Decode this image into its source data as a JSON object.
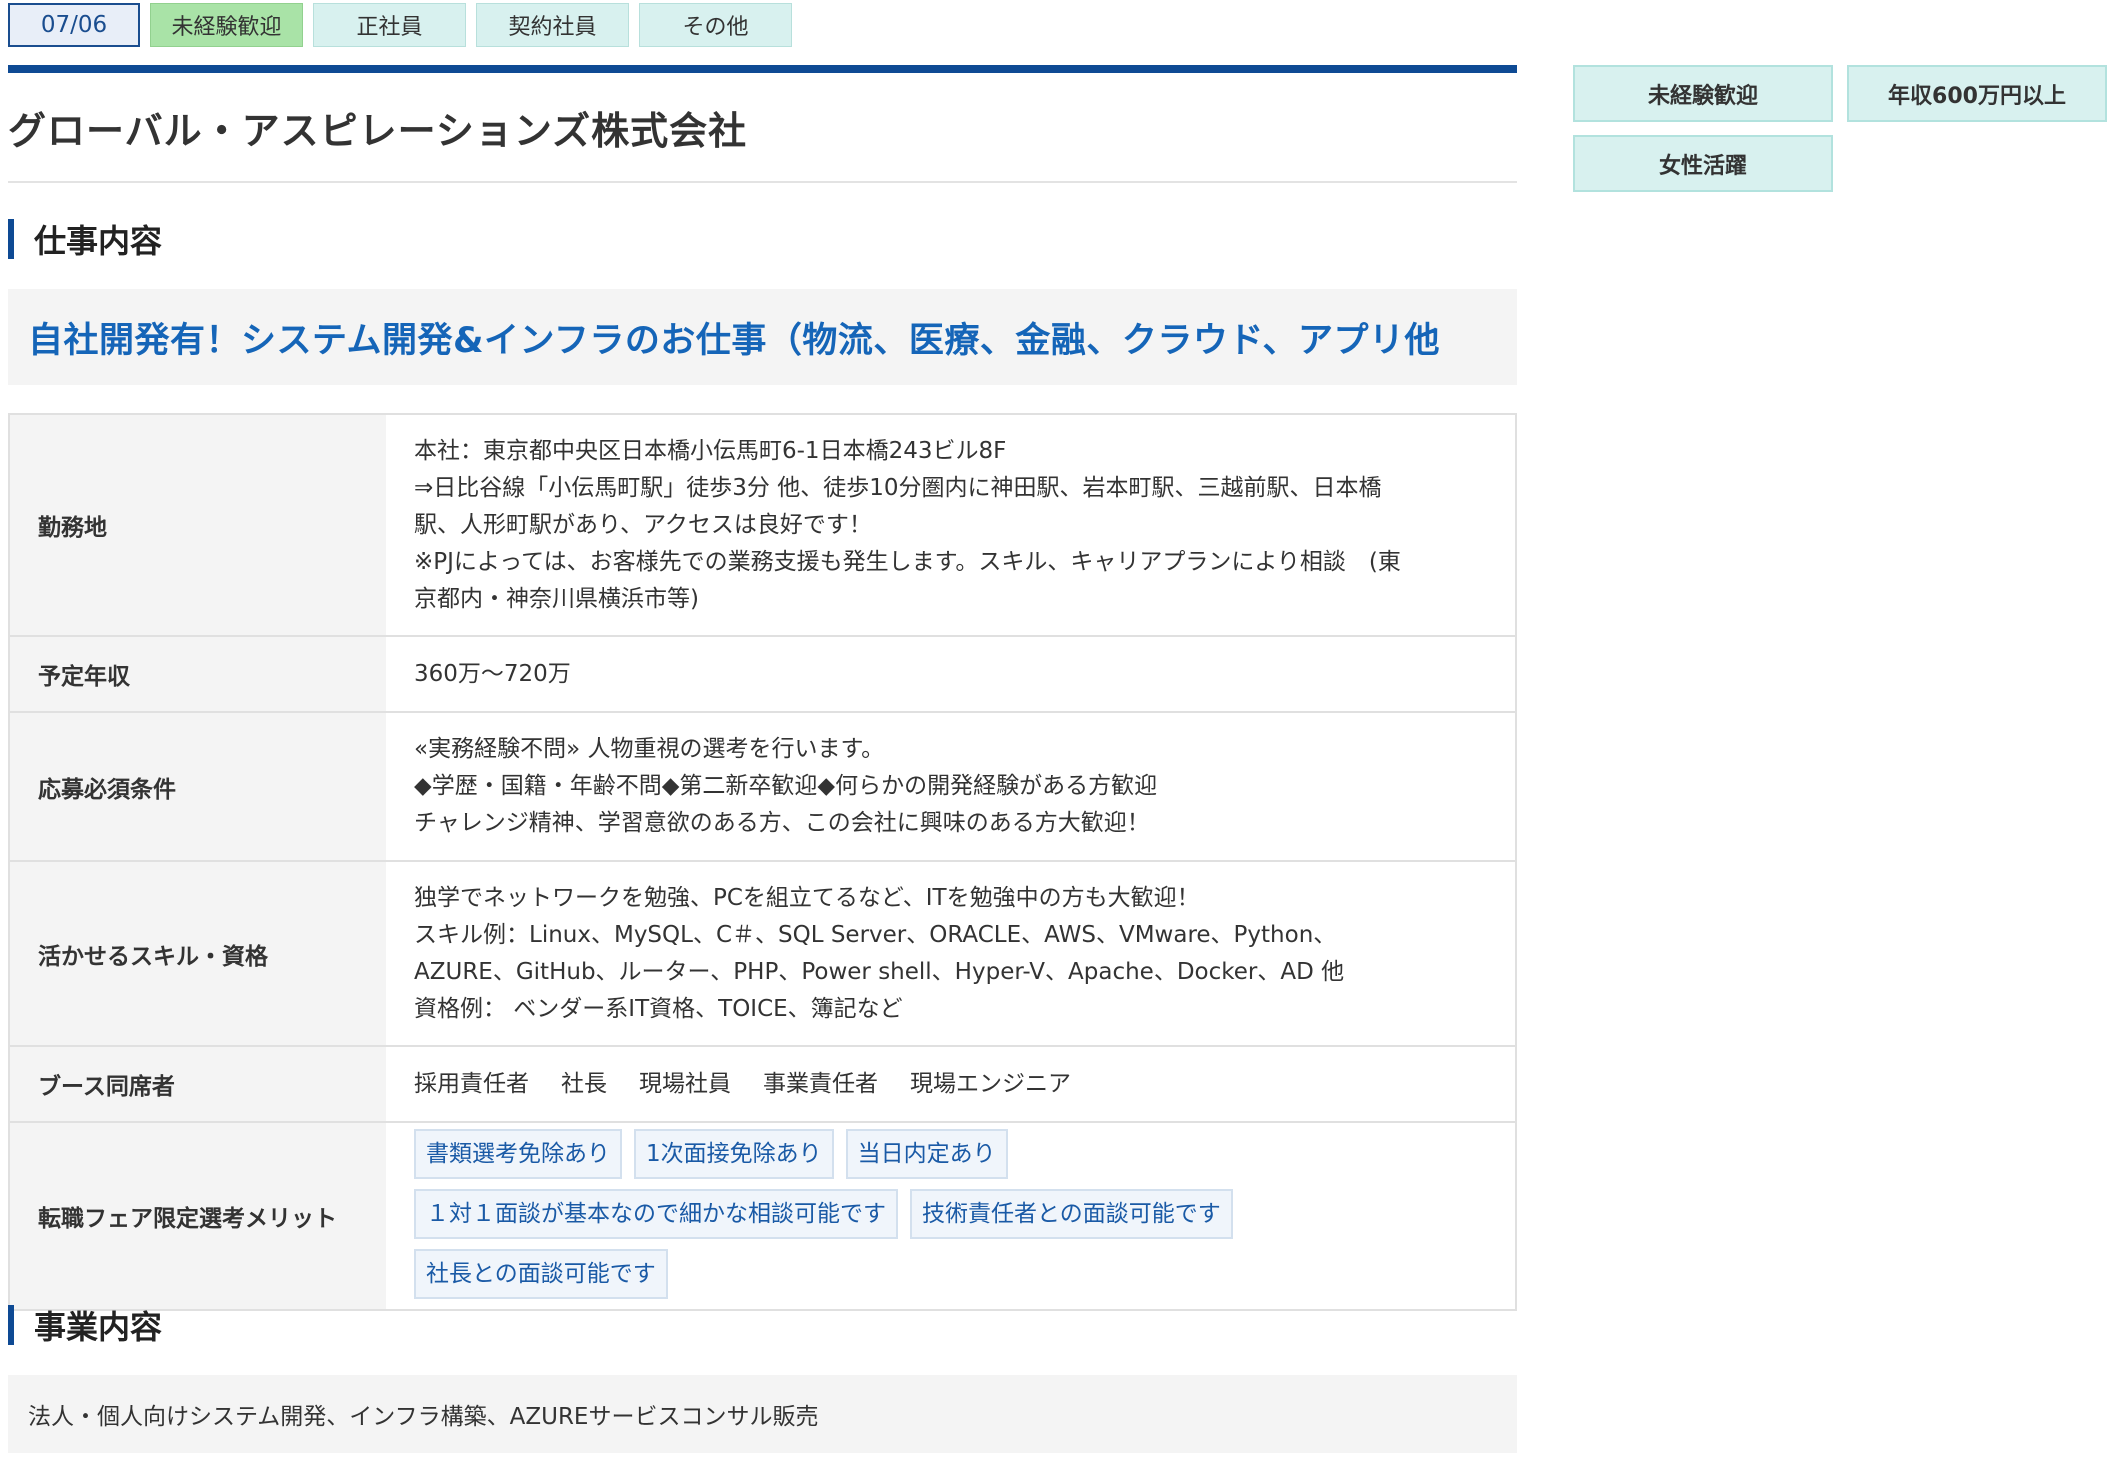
{
  "top": {
    "date": "07/06",
    "tags": [
      {
        "label": "未経験歓迎",
        "highlight": true
      },
      {
        "label": "正社員",
        "highlight": false
      },
      {
        "label": "契約社員",
        "highlight": false
      },
      {
        "label": "その他",
        "highlight": false
      }
    ]
  },
  "company": {
    "name": "グローバル・アスピレーションズ株式会社"
  },
  "job": {
    "heading": "仕事内容",
    "catch": "自社開発有！システム開発&インフラのお仕事（物流、医療、金融、クラウド、アプリ他"
  },
  "details": {
    "location": {
      "label": "勤務地",
      "lines": [
        "本社：東京都中央区日本橋小伝馬町6-1日本橋243ビル8F",
        "⇒日比谷線「小伝馬町駅」徒歩3分 他、徒歩10分圏内に神田駅、岩本町駅、三越前駅、日本橋",
        "駅、人形町駅があり、アクセスは良好です！",
        "※PJによっては、お客様先での業務支援も発生します。スキル、キャリアプランにより相談　(東",
        "京都内・神奈川県横浜市等)"
      ]
    },
    "salary": {
      "label": "予定年収",
      "value": "360万〜720万"
    },
    "requirements": {
      "label": "応募必須条件",
      "lines": [
        "«実務経験不問» 人物重視の選考を行います。",
        "◆学歴・国籍・年齢不問◆第二新卒歓迎◆何らかの開発経験がある方歓迎",
        "チャレンジ精神、学習意欲のある方、この会社に興味のある方大歓迎！"
      ]
    },
    "skills": {
      "label": "活かせるスキル・資格",
      "lines": [
        "独学でネットワークを勉強、PCを組立てるなど、ITを勉強中の方も大歓迎！",
        "スキル例：Linux、MySQL、C＃、SQL Server、ORACLE、AWS、VMware、Python、",
        "AZURE、GitHub、ルーター、PHP、Power shell、Hyper-V、Apache、Docker、AD 他",
        "資格例： ベンダー系IT資格、TOICE、簿記など"
      ]
    },
    "booth": {
      "label": "ブース同席者",
      "members": [
        "採用責任者",
        "社長",
        "現場社員",
        "事業責任者",
        "現場エンジニア"
      ]
    },
    "merits": {
      "label": "転職フェア限定選考メリット",
      "items": [
        "書類選考免除あり",
        "1次面接免除あり",
        "当日内定あり",
        "１対１面談が基本なので細かな相談可能です",
        "技術責任者との面談可能です",
        "社長との面談可能です"
      ]
    }
  },
  "business": {
    "heading": "事業内容",
    "text": "法人・個人向けシステム開発、インフラ構築、AZUREサービスコンサル販売"
  },
  "side_tags": [
    "未経験歓迎",
    "年収600万円以上",
    "女性活躍"
  ],
  "colors": {
    "accent": "#0e4a94",
    "catch_text": "#1565b8",
    "tag_bg": "#d8f1ef",
    "tag_green": "#a9e3a7"
  }
}
